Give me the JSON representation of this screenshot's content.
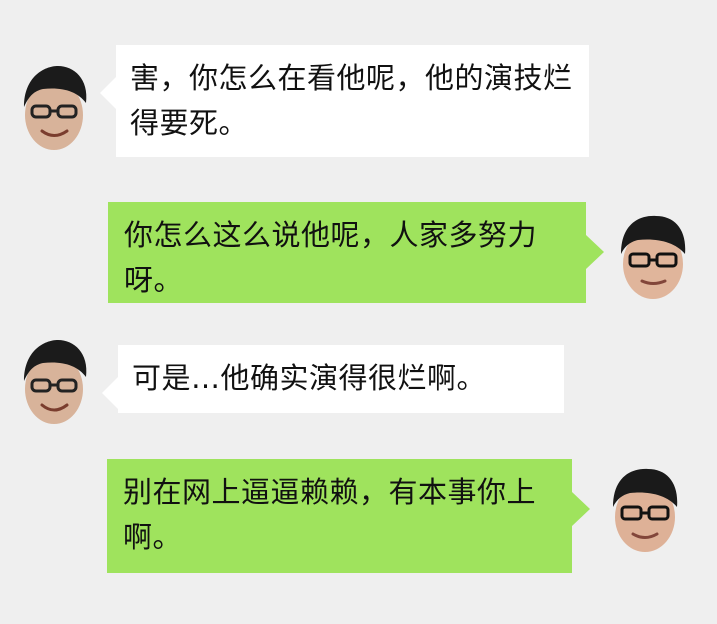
{
  "messages": [
    {
      "sender": "left",
      "text": "害，你怎么在看他呢，他的演技烂得要死。"
    },
    {
      "sender": "right",
      "text": "你怎么这么说他呢，人家多努力呀。"
    },
    {
      "sender": "left",
      "text": " 可是…他确实演得很烂啊。"
    },
    {
      "sender": "right",
      "text": "别在网上逼逼赖赖，有本事你上啊。"
    }
  ]
}
